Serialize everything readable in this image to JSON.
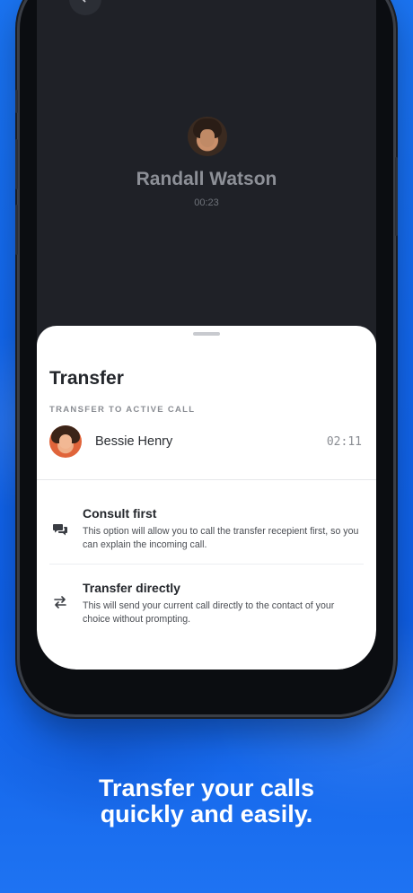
{
  "call": {
    "caller_name": "Randall Watson",
    "duration": "00:23"
  },
  "transfer_sheet": {
    "title": "Transfer",
    "section_label": "TRANSFER TO ACTIVE CALL",
    "active_contact": {
      "name": "Bessie Henry",
      "duration": "02:11"
    },
    "options": [
      {
        "icon": "chat-bubbles-icon",
        "title": "Consult first",
        "description": "This option will allow you to call the transfer recepient first, so you can explain the incoming call."
      },
      {
        "icon": "swap-arrows-icon",
        "title": "Transfer directly",
        "description": "This will send your current call directly to the contact of your choice without prompting."
      }
    ]
  },
  "marketing": {
    "headline_line1": "Transfer your calls",
    "headline_line2": "quickly and easily."
  },
  "colors": {
    "background_blue": "#1266ec",
    "screen_dark": "#1f2127",
    "sheet_white": "#ffffff"
  }
}
